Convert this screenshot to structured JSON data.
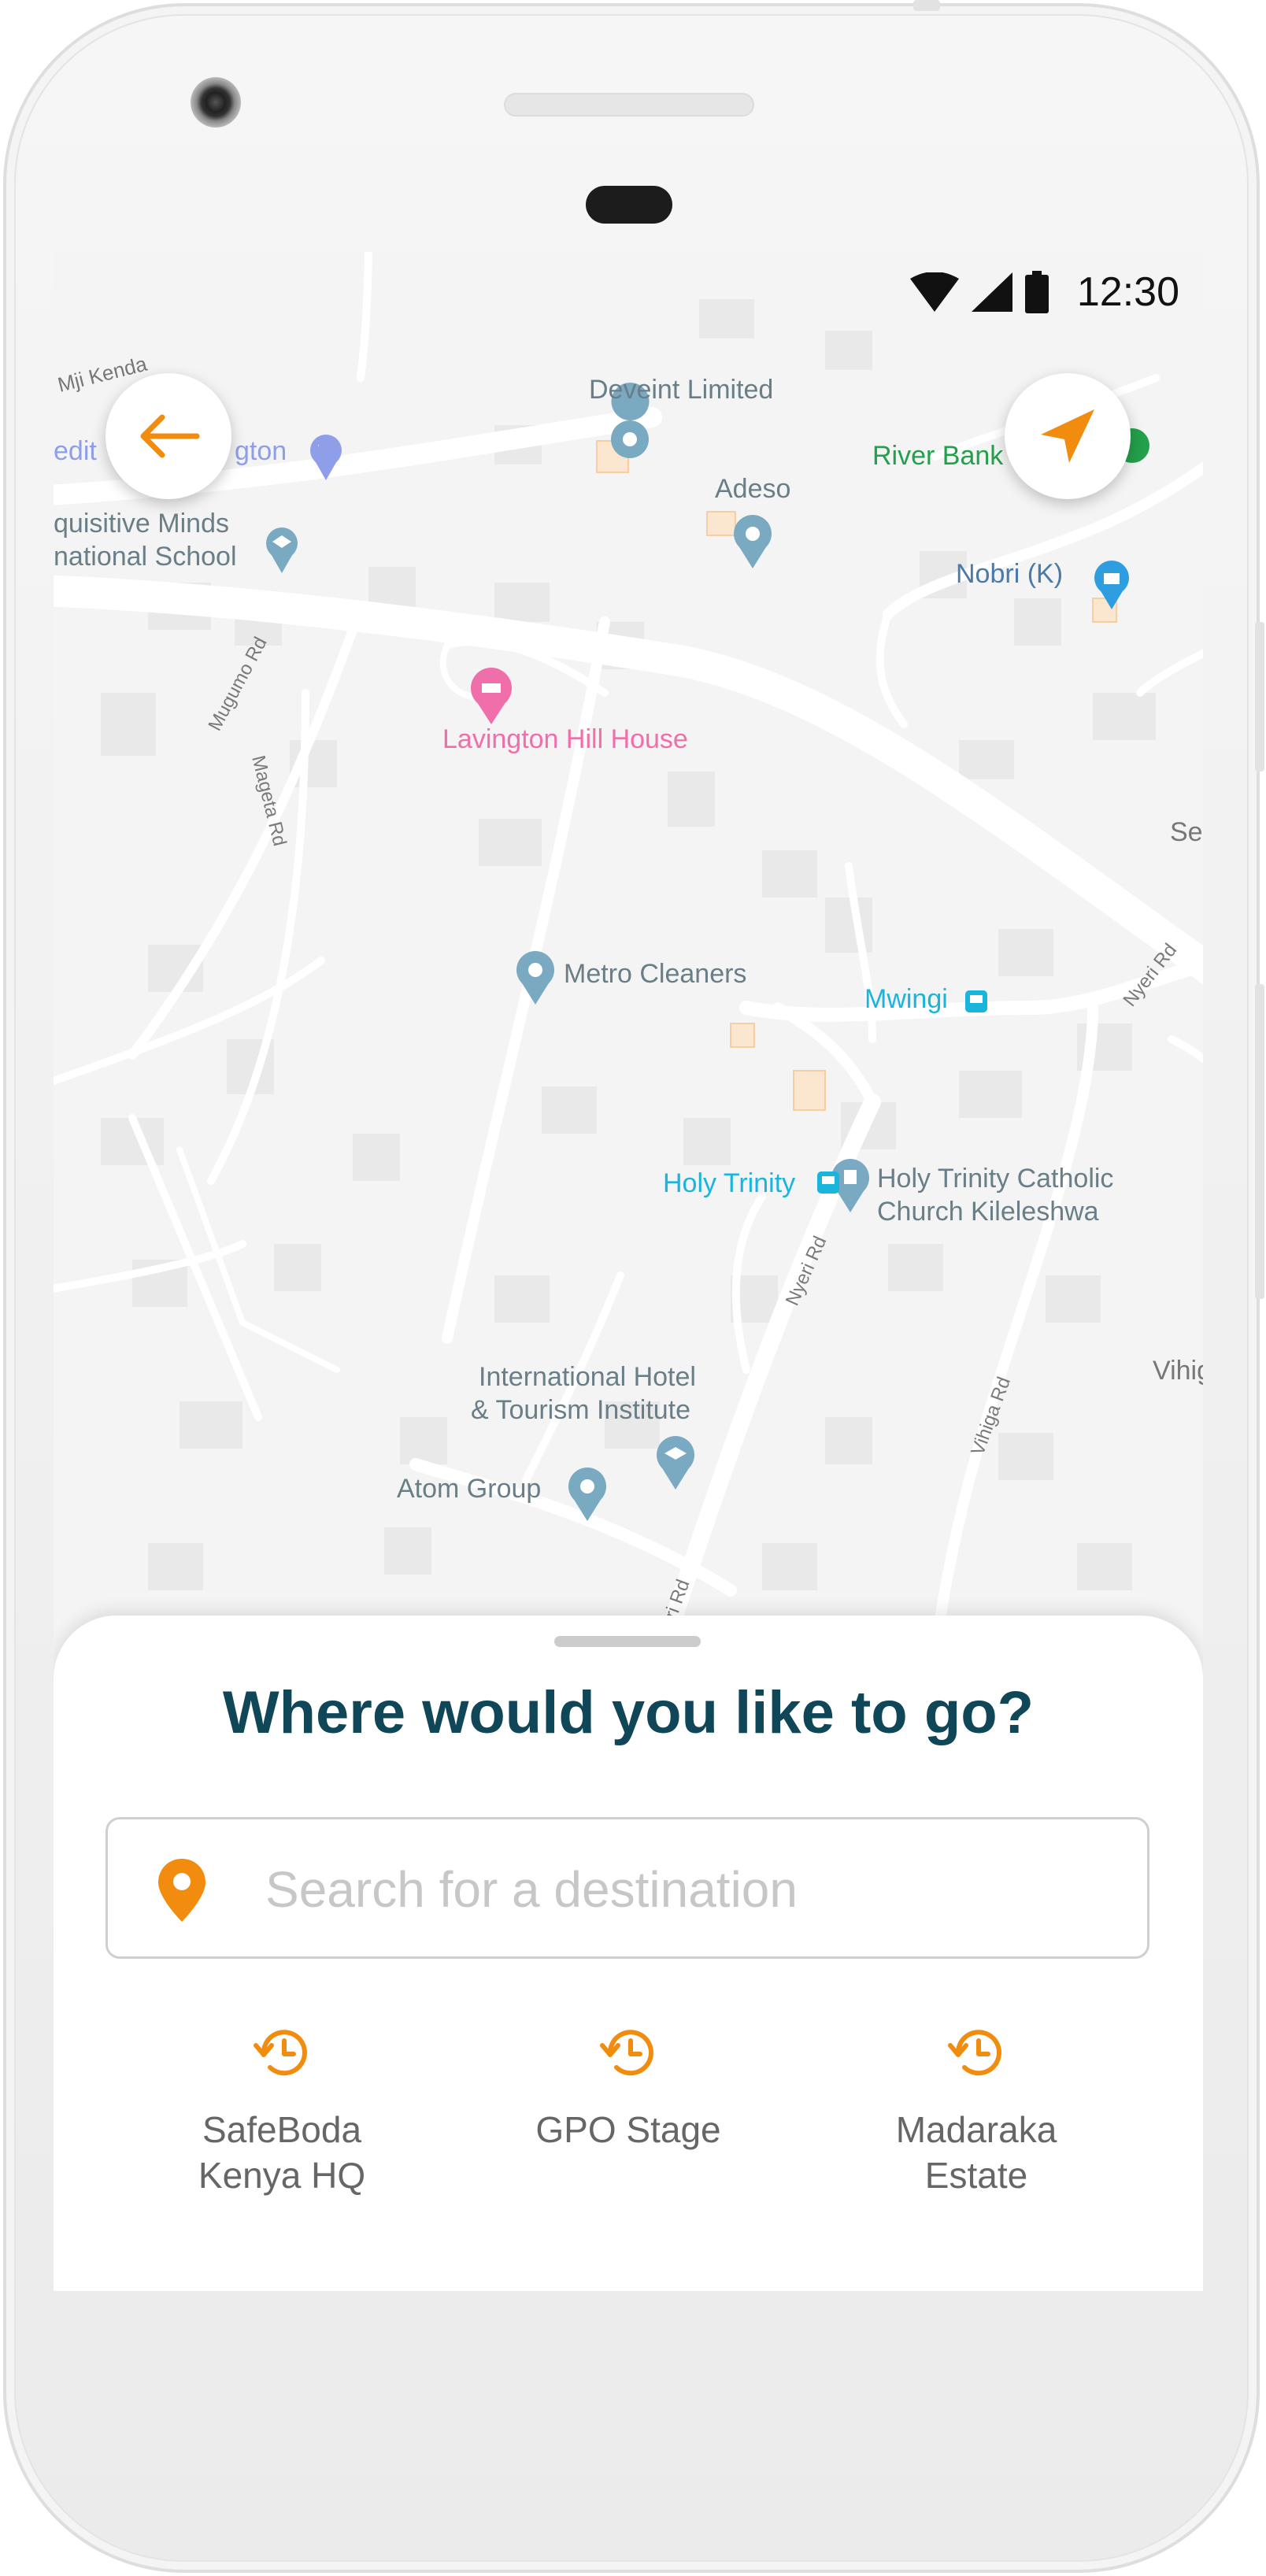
{
  "status_bar": {
    "time": "12:30"
  },
  "map": {
    "labels": {
      "mji_kenda": "Mji Kenda",
      "credit_left": "edit",
      "credit_right": "gton",
      "deveint": "Deveint Limited",
      "adeso": "Adeso",
      "river_bank": "River Bank",
      "nobri": "Nobri (K)",
      "inquisitive_1": "quisitive Minds",
      "inquisitive_2": "national School",
      "mugumo_rd": "Mugumo Rd",
      "mageta_rd": "Mageta Rd",
      "lavington": "Lavington Hill House",
      "se": "Se",
      "metro": "Metro Cleaners",
      "mwingi": "Mwingi",
      "nyeri_rd_1": "Nyeri Rd",
      "holy_trinity": "Holy Trinity",
      "holy_church_1": "Holy Trinity Catholic",
      "holy_church_2": "Church Kileleshwa",
      "nyeri_rd_2": "Nyeri Rd",
      "intl_hotel_1": "International Hotel",
      "intl_hotel_2": "& Tourism Institute",
      "vihiga_rd": "Vihiga Rd",
      "vihig": "Vihig",
      "atom": "Atom Group",
      "nyeri_rd_3": "eri Rd"
    }
  },
  "sheet": {
    "title": "Where would you like to go?",
    "search_placeholder": "Search for a destination",
    "recents": [
      {
        "label": "SafeBoda\nKenya HQ"
      },
      {
        "label": "GPO Stage"
      },
      {
        "label": "Madaraka\nEstate"
      }
    ]
  },
  "colors": {
    "accent": "#f28c0f",
    "title": "#0f4658",
    "map_bg": "#f4f4f4",
    "poi_blue": "#7aa9c2",
    "transit": "#19b5dc",
    "pink": "#f06ea9",
    "green": "#23a04b"
  },
  "icons": {
    "back": "arrow-left-icon",
    "locate": "navigation-arrow-icon",
    "search_pin": "map-pin-icon",
    "recent": "history-clock-icon"
  }
}
